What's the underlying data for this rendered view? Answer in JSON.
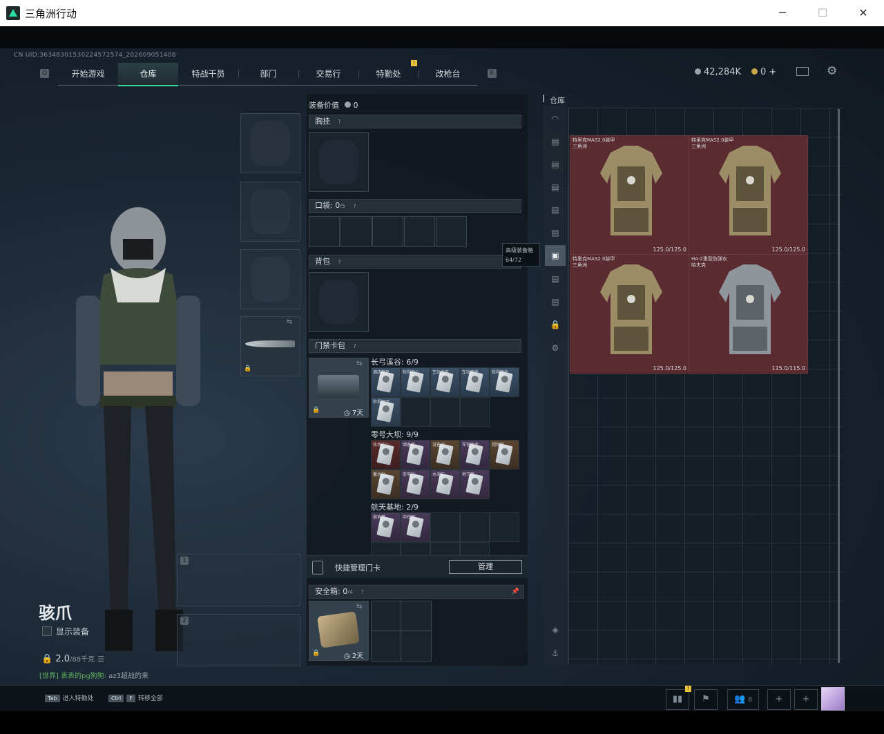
{
  "window": {
    "title": "三角洲行动",
    "minimize": "─",
    "maximize": "☐",
    "close": "✕"
  },
  "uid": "CN UID:36348301530224572574_202609051408",
  "nav": {
    "left_key": "Q",
    "right_key": "E",
    "tabs": [
      "开始游戏",
      "仓库",
      "特战干员",
      "部门",
      "交易行",
      "特勤处",
      "改枪台"
    ],
    "active": "仓库",
    "badge": "!"
  },
  "currency": {
    "coins": "42,284K",
    "premium": "0",
    "add": "+"
  },
  "operator": {
    "name": "骇爪",
    "show_equipment": "显示装备",
    "weight": "2.0",
    "weight_max": "/88千克"
  },
  "chat": {
    "channel": "[世界] 表表的pg狗狗:",
    "text": " az3超战的来"
  },
  "equipment": {
    "value_label": "装备价值",
    "value": "0"
  },
  "sections": {
    "chest": "胸挂",
    "pocket": "口袋:",
    "pocket_count": "0",
    "pocket_max": "/5",
    "backpack": "背包",
    "keycard": "门禁卡包",
    "safebox": "安全箱:",
    "safebox_count": "0",
    "safebox_max": "/4"
  },
  "keycard_case": {
    "days": "7天"
  },
  "safebox_case": {
    "days": "2天"
  },
  "maps": [
    {
      "name": "长弓溪谷",
      "count": "6/9",
      "cards": [
        {
          "label": "酒店套房",
          "color": "blue"
        },
        {
          "label": "检视中心",
          "color": "blue"
        },
        {
          "label": "车站仓库",
          "color": "blue"
        },
        {
          "label": "车站宿舍",
          "color": "blue"
        },
        {
          "label": "检视宿舍",
          "color": "blue"
        },
        {
          "label": "检视观测",
          "color": "blue"
        }
      ]
    },
    {
      "name": "零号大坝",
      "count": "9/9",
      "cards": [
        {
          "label": "技术中心",
          "color": "red"
        },
        {
          "label": "储备室",
          "color": "purple"
        },
        {
          "label": "设备间",
          "color": "brown"
        },
        {
          "label": "军营宿舍",
          "color": "purple"
        },
        {
          "label": "视频室",
          "color": "brown"
        },
        {
          "label": "蓄水站",
          "color": "brown"
        },
        {
          "label": "变电站",
          "color": "purple"
        },
        {
          "label": "水泥厂",
          "color": "purple"
        },
        {
          "label": "地下室",
          "color": "purple"
        }
      ]
    },
    {
      "name": "航天基地",
      "count": "2/9",
      "cards": [
        {
          "label": "宿舍楼",
          "color": "purple"
        },
        {
          "label": "中控室",
          "color": "purple"
        }
      ]
    }
  ],
  "quick_manage": {
    "label": "快捷管理门卡",
    "button": "管理"
  },
  "tooltip": {
    "title": "高级装备箱",
    "count": "64/72"
  },
  "stash": {
    "label": "仓库"
  },
  "stash_items": [
    {
      "name": "特里克MAS2.0装甲",
      "maker": "三角洲",
      "durability": "125.0/125.0"
    },
    {
      "name": "特里克MAS2.0装甲",
      "maker": "三角洲",
      "durability": "125.0/125.0"
    },
    {
      "name": "特里克MAS2.0装甲",
      "maker": "三角洲",
      "durability": "125.0/125.0"
    },
    {
      "name": "HA-2重型防弹衣",
      "maker": "哈夫克",
      "durability": "115.0/115.0"
    }
  ],
  "weapon_slots": [
    "1",
    "2"
  ],
  "bottom": {
    "hint1_key": "Tab",
    "hint1": "进入特勤处",
    "hint2_key1": "Ctrl",
    "hint2_key2": "F",
    "hint2": "转移全部",
    "friends": "8"
  },
  "colors": {
    "accent": "#2fd9a0",
    "armor_bg": "#5a2b30",
    "badge": "#e8c23a"
  }
}
